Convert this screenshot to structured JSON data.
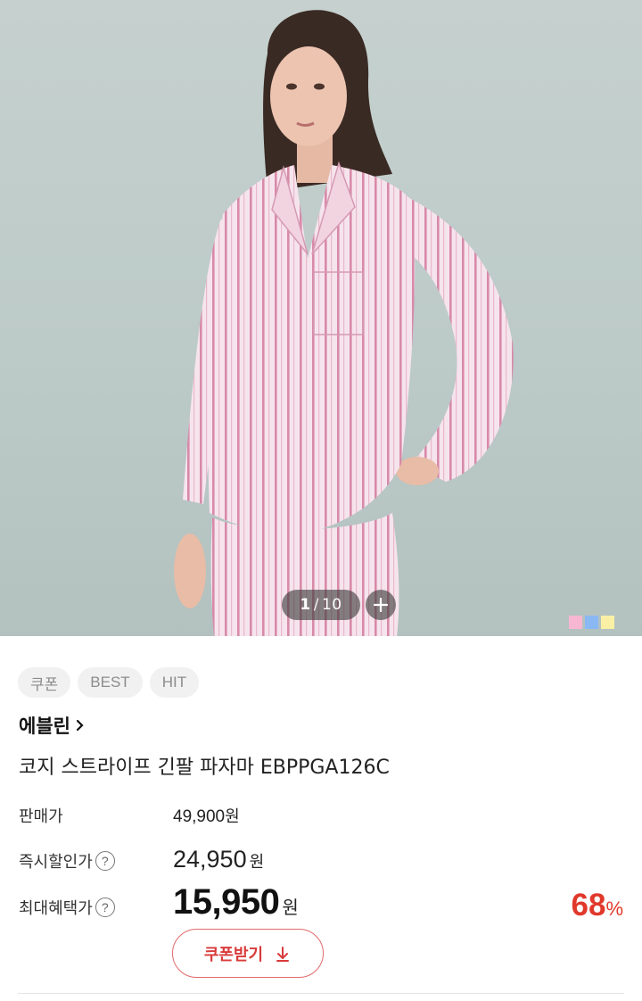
{
  "gallery": {
    "current": "1",
    "separator": "/",
    "total": "10",
    "swatch_colors": [
      "#f7b7d3",
      "#8ab8f2",
      "#f9f0a6"
    ]
  },
  "tags": [
    "쿠폰",
    "BEST",
    "HIT"
  ],
  "product": {
    "brand": "에블린",
    "name": "코지 스트라이프 긴팔 파자마 EBPPGA126C"
  },
  "prices": {
    "sale_label": "판매가",
    "sale_value": "49,900",
    "sale_unit": "원",
    "instant_label": "즉시할인가",
    "instant_value": "24,950",
    "instant_unit": "원",
    "max_label": "최대혜택가",
    "max_value": "15,950",
    "max_unit": "원",
    "discount_rate": "68",
    "discount_unit": "%"
  },
  "coupon": {
    "label": "쿠폰받기"
  },
  "colors": {
    "accent": "#e0392b"
  }
}
